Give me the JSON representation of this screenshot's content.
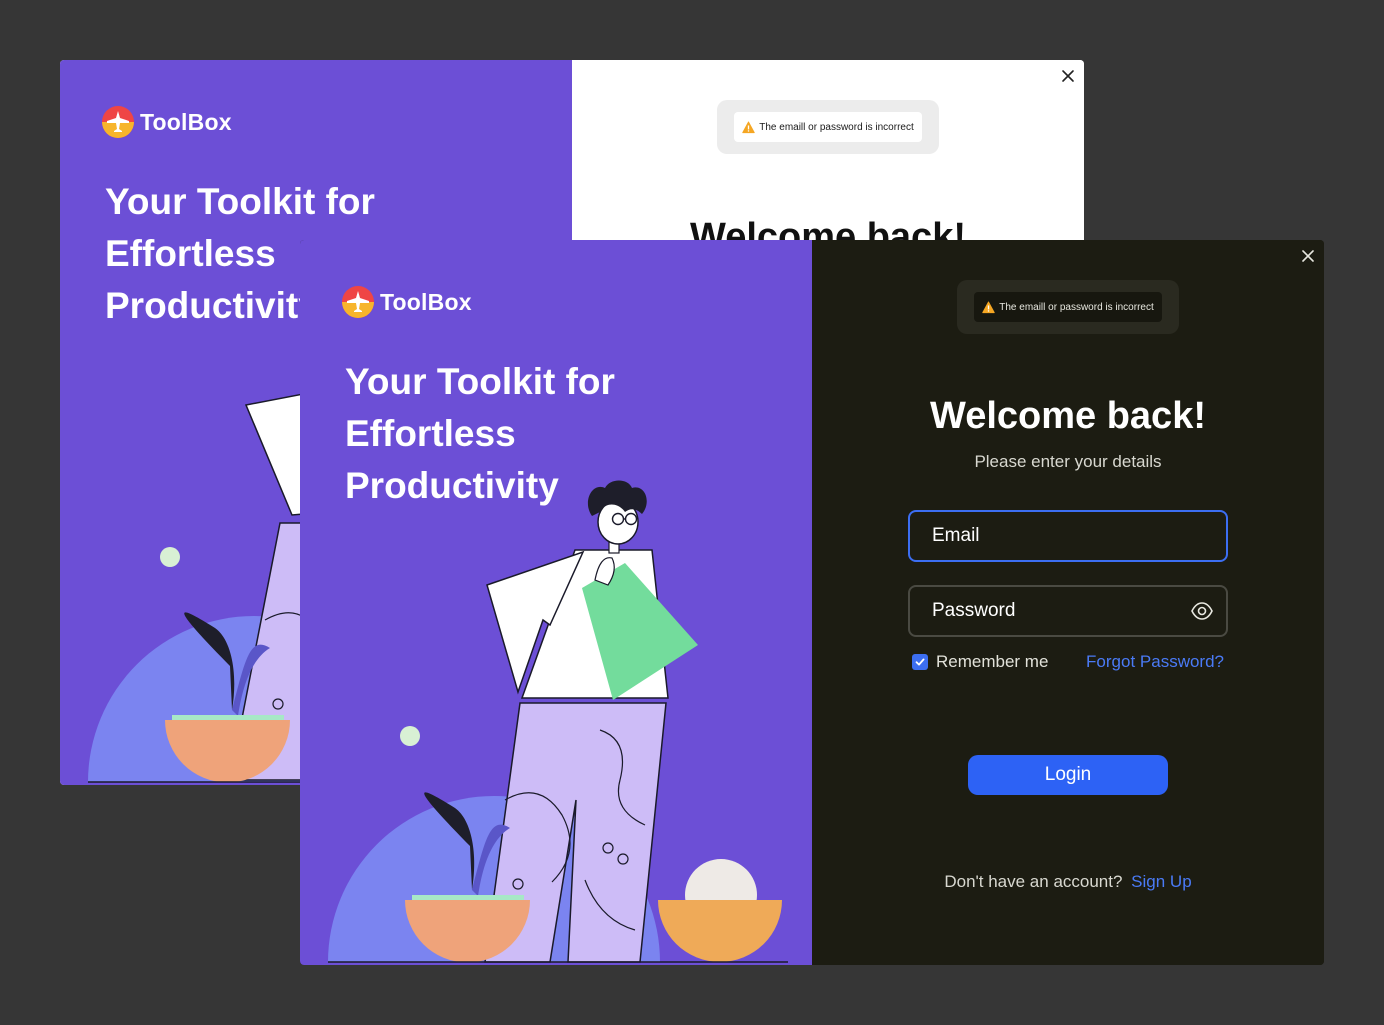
{
  "brand": {
    "name": "ToolBox"
  },
  "promo": {
    "headline": [
      "Your Toolkit for",
      "Effortless",
      "Productivity"
    ]
  },
  "login": {
    "error_message": "The emaill or password is incorrect",
    "title": "Welcome back!",
    "subtitle": "Please enter your details",
    "email_placeholder": "Email",
    "password_placeholder": "Password",
    "remember_label": "Remember me",
    "remember_checked": true,
    "forgot_label": "Forgot Password?",
    "login_label": "Login",
    "no_account_text": "Don't have an account?",
    "signup_label": "Sign Up"
  },
  "colors": {
    "promo_bg": "#6c4fd6",
    "panel_dark_bg": "#1c1c12",
    "accent": "#2d62f5",
    "link": "#4a7af5",
    "warning": "#f5a623"
  },
  "icons": {
    "close": "close-icon",
    "warning": "warning-icon",
    "password_toggle": "eye-icon",
    "logo": "airplane-logo-icon"
  }
}
